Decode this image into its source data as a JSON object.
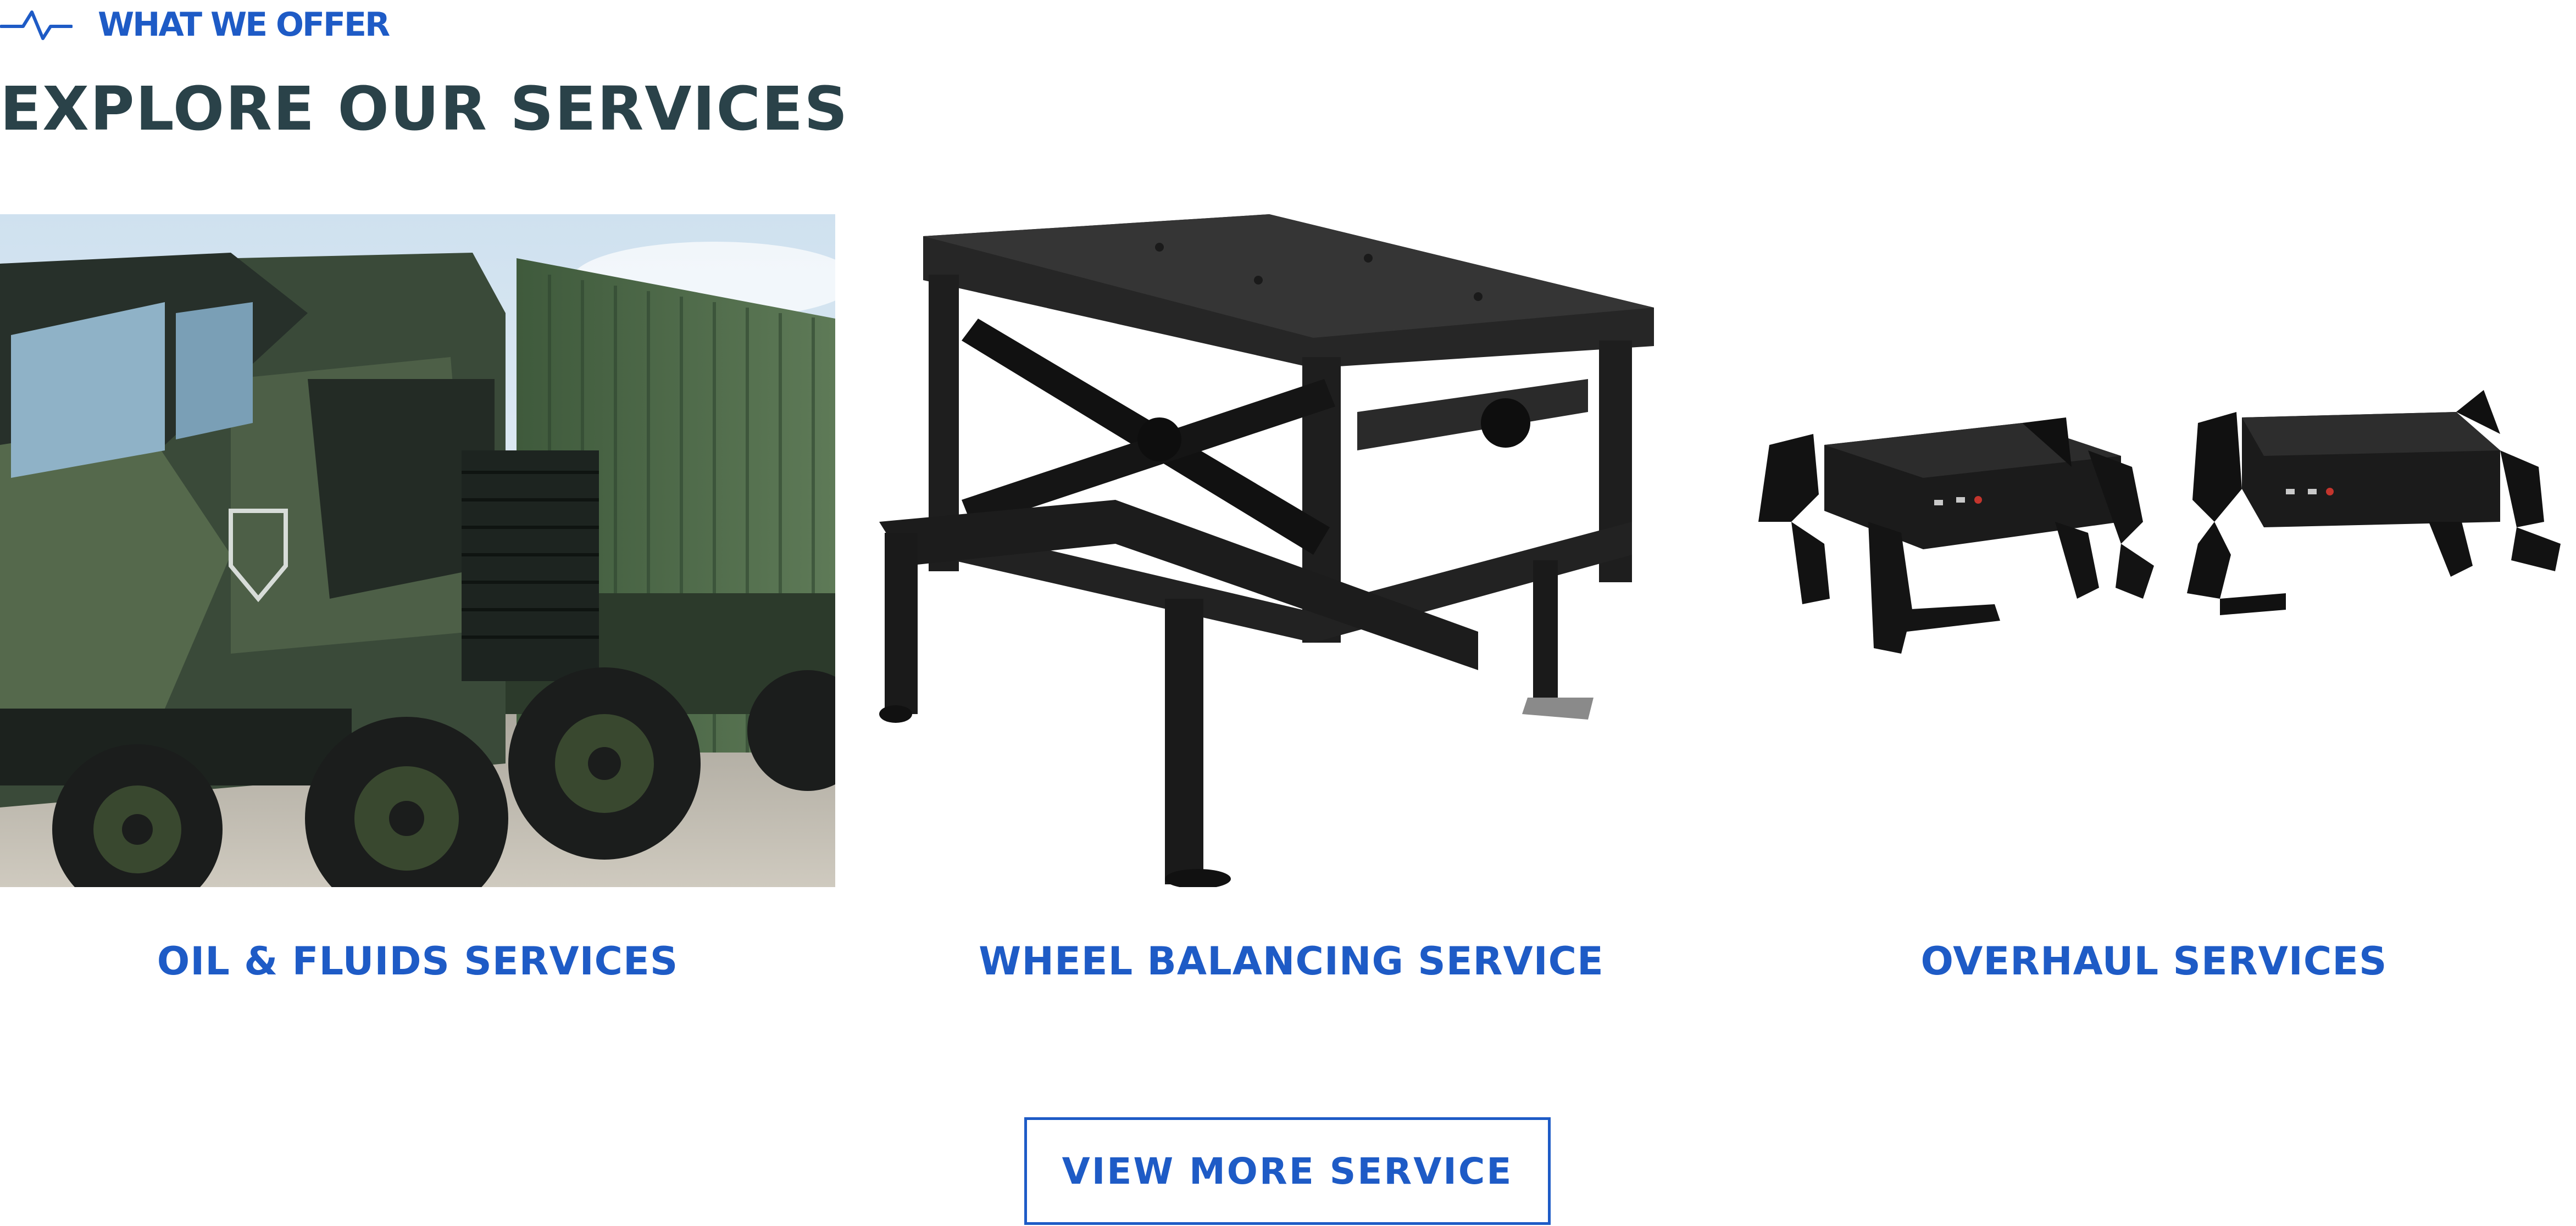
{
  "header": {
    "eyebrow": "WHAT WE OFFER",
    "eyebrow_icon": "pulse-line-icon",
    "title": "EXPLORE OUR SERVICES"
  },
  "services": [
    {
      "title": "OIL & FLUIDS SERVICES",
      "image": "military-truck-photo"
    },
    {
      "title": "WHEEL BALANCING SERVICE",
      "image": "scissor-lift-table-photo"
    },
    {
      "title": "OVERHAUL SERVICES",
      "image": "quadruped-robots-photo"
    }
  ],
  "cta": {
    "label": "VIEW MORE SERVICE"
  },
  "colors": {
    "accent": "#1e5bc6",
    "heading": "#2a4249",
    "background": "#ffffff"
  }
}
